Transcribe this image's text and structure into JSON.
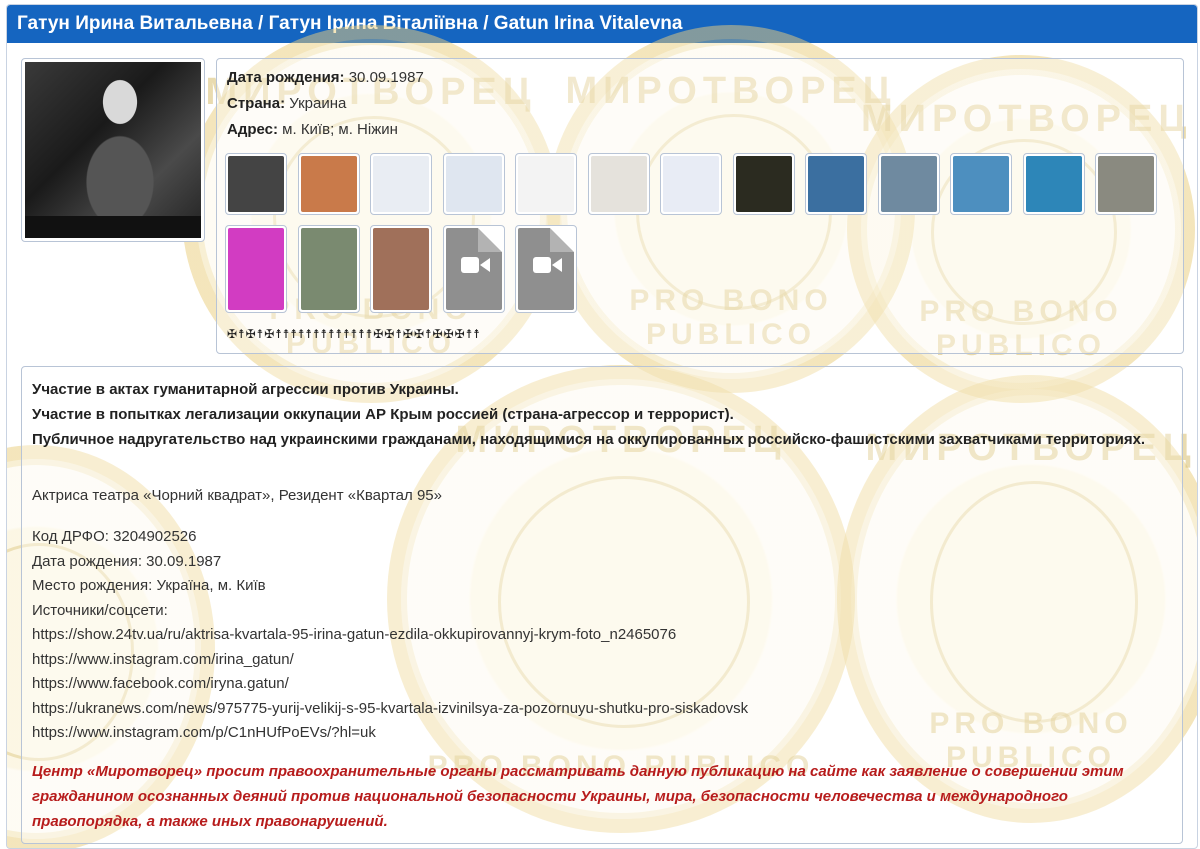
{
  "title": "Гатун Ирина Витальевна / Гатун Ірина Віталіївна / Gatun Irina Vitalevna",
  "watermark": {
    "top_text": "МИРОТВОРЕЦ",
    "bottom_text": "PRO BONO PUBLICO",
    "color": "#e8cd78"
  },
  "profile": {
    "birth_label": "Дата рождения:",
    "birth_value": "30.09.1987",
    "country_label": "Страна:",
    "country_value": "Украина",
    "address_label": "Адрес:",
    "address_value": "м. Київ; м. Ніжин"
  },
  "thumbnails": [
    {
      "kind": "photo",
      "color": "#444444"
    },
    {
      "kind": "photo",
      "color": "#c97a4a"
    },
    {
      "kind": "doc",
      "color": "#e9edf3"
    },
    {
      "kind": "doc",
      "color": "#dfe6f0"
    },
    {
      "kind": "doc",
      "color": "#f3f3f3"
    },
    {
      "kind": "doc",
      "color": "#e5e2dc"
    },
    {
      "kind": "doc",
      "color": "#e8ecf5"
    },
    {
      "kind": "photo",
      "color": "#2b2b20"
    },
    {
      "kind": "photo",
      "color": "#3b6fa0"
    },
    {
      "kind": "photo",
      "color": "#6f8aa0"
    },
    {
      "kind": "photo",
      "color": "#4d8fbf"
    },
    {
      "kind": "photo",
      "color": "#2d86b8"
    },
    {
      "kind": "photo",
      "color": "#8a8a80"
    },
    {
      "kind": "photo",
      "color": "#d23cc2"
    },
    {
      "kind": "photo",
      "color": "#7a8a70"
    },
    {
      "kind": "photo",
      "color": "#a0705a"
    },
    {
      "kind": "video",
      "color": "#8f8f8f"
    },
    {
      "kind": "video",
      "color": "#8f8f8f"
    }
  ],
  "crosses": "✠☨✠☨✠☨☨☨☨☨☨☨☨☨☨☨☨☨✠✠☨✠✠☨✠✠✠☨☨",
  "accusations": [
    "Участие в актах гуманитарной агрессии против Украины.",
    "Участие в попытках легализации оккупации АР Крым россией (страна-агрессор и террорист).",
    "Публичное надругательство над украинскими гражданами, находящимися на оккупированных российско-фашистскими захватчиками территориях."
  ],
  "role": "Актриса театра «Чорний квадрат», Резидент «Квартал 95»",
  "details": {
    "drfo": "Код ДРФО: 3204902526",
    "birth": "Дата рождения: 30.09.1987",
    "birthplace": "Место рождения: Україна, м. Київ",
    "sources_label": "Источники/соцсети:",
    "links": [
      "https://show.24tv.ua/ru/aktrisa-kvartala-95-irina-gatun-ezdila-okkupirovannyj-krym-foto_n2465076",
      "https://www.instagram.com/irina_gatun/",
      "https://www.facebook.com/iryna.gatun/",
      "https://ukranews.com/news/975775-yurij-velikij-s-95-kvartala-izvinilsya-za-pozornuyu-shutku-pro-siskadovsk",
      "https://www.instagram.com/p/C1nHUfPoEVs/?hl=uk"
    ]
  },
  "notice": "Центр «Миротворец» просит правоохранительные органы рассматривать данную публикацию на сайте как заявление о совершении этим гражданином осознанных деяний против национальной безопасности Украины, мира, безопасности человечества и международного правопорядка, а также иных правонарушений.",
  "colors": {
    "header": "#1565c0",
    "notice": "#b71c1c"
  }
}
